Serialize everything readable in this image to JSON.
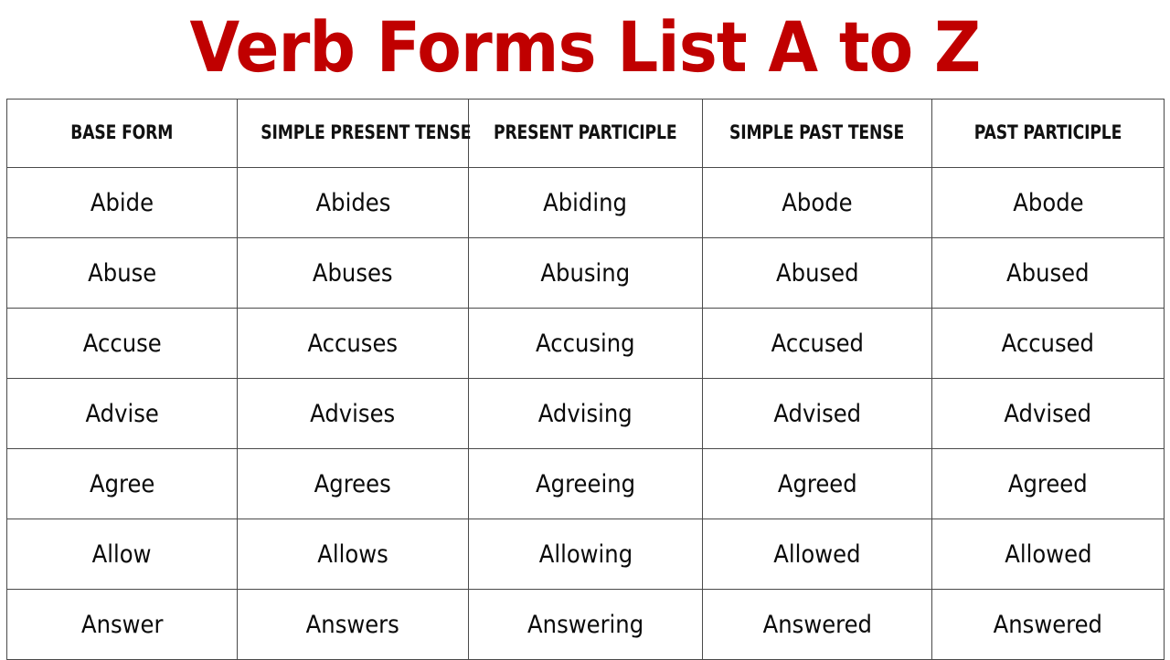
{
  "document": {
    "title": "Verb Forms List A to Z",
    "title_color": "#C00000",
    "background_color": "#FFFFFF"
  },
  "table": {
    "header_background": "#E9E9E9",
    "border_color": "#4A4A4A",
    "text_color": "#0A0A0A",
    "columns": [
      "BASE FORM",
      "SIMPLE PRESENT TENSE",
      "PRESENT PARTICIPLE",
      "SIMPLE PAST TENSE",
      "PAST PARTICIPLE"
    ],
    "rows": [
      [
        "Abide",
        "Abides",
        "Abiding",
        "Abode",
        "Abode"
      ],
      [
        "Abuse",
        "Abuses",
        "Abusing",
        "Abused",
        "Abused"
      ],
      [
        "Accuse",
        "Accuses",
        "Accusing",
        "Accused",
        "Accused"
      ],
      [
        "Advise",
        "Advises",
        "Advising",
        "Advised",
        "Advised"
      ],
      [
        "Agree",
        "Agrees",
        "Agreeing",
        "Agreed",
        "Agreed"
      ],
      [
        "Allow",
        "Allows",
        "Allowing",
        "Allowed",
        "Allowed"
      ],
      [
        "Answer",
        "Answers",
        "Answering",
        "Answered",
        "Answered"
      ]
    ]
  }
}
